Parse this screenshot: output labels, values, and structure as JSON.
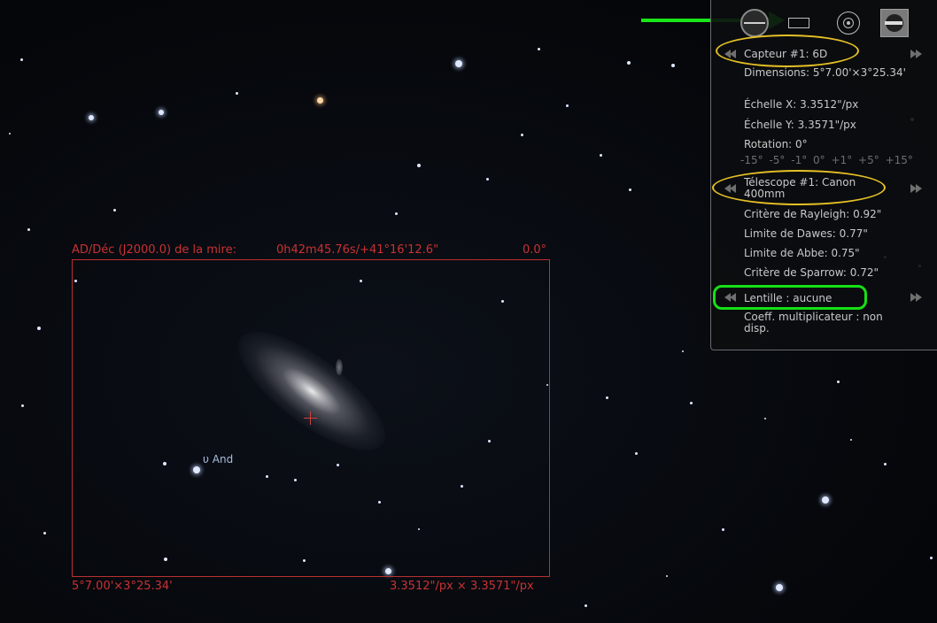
{
  "sky": {
    "star_label": "υ And"
  },
  "ccd_frame": {
    "top_left_label": "AD/Déc (J2000.0) de la mire:",
    "coordinates": "0h42m45.76s/+41°16'12.6\"",
    "rotation": "0.0°",
    "bottom_left_label": "5°7.00'×3°25.34'",
    "bottom_right_label": "3.3512\"/px × 3.3571\"/px"
  },
  "oculars_panel": {
    "toolbar": [
      {
        "name": "ocular",
        "icon": "ocular-icon"
      },
      {
        "name": "ccd",
        "icon": "ccd-frame-icon"
      },
      {
        "name": "telrad",
        "icon": "telrad-icon"
      },
      {
        "name": "configure",
        "icon": "configure-icon"
      }
    ],
    "sensor": {
      "title": "Capteur #1: 6D",
      "dimensions": "Dimensions: 5°7.00'×3°25.34'",
      "scale_x": "Échelle X: 3.3512\"/px",
      "scale_y": "Échelle Y: 3.3571\"/px",
      "rotation": "Rotation: 0°",
      "rotation_options": [
        "-15°",
        "-5°",
        "-1°",
        "0°",
        "+1°",
        "+5°",
        "+15°"
      ]
    },
    "telescope": {
      "title": "Télescope #1: Canon 400mm",
      "rayleigh": "Critère de Rayleigh: 0.92\"",
      "dawes": "Limite de Dawes: 0.77\"",
      "abbe": "Limite de Abbe: 0.75\"",
      "sparrow": "Critère de Sparrow: 0.72\""
    },
    "lens": {
      "title": "Lentille : aucune",
      "multiplier": "Coeff. multiplicateur : non disp."
    }
  },
  "colors": {
    "frame": "#b83030",
    "annotation_yellow": "#e5c026",
    "annotation_green": "#16e016"
  }
}
